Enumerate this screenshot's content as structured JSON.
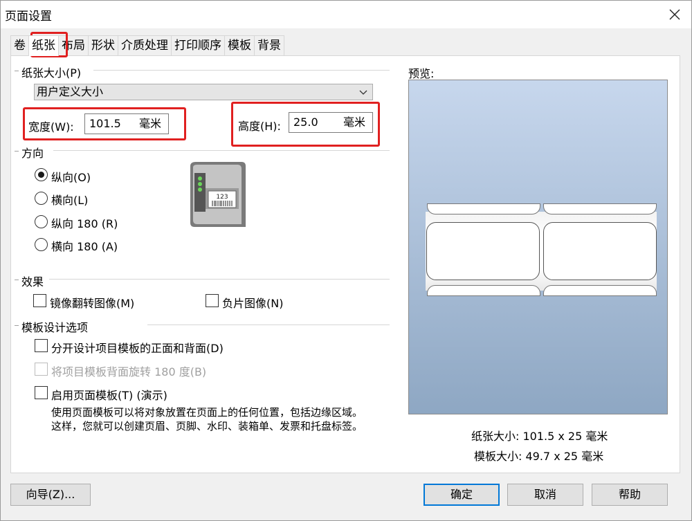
{
  "window": {
    "title": "页面设置"
  },
  "tabs": [
    "卷",
    "纸张",
    "布局",
    "形状",
    "介质处理",
    "打印顺序",
    "模板",
    "背景"
  ],
  "paper_size": {
    "group_label": "纸张大小(P)",
    "selected": "用户定义大小",
    "width_label": "宽度(W):",
    "width_value": "101.5",
    "height_label": "高度(H):",
    "height_value": "25.0",
    "unit": "毫米"
  },
  "orientation": {
    "group_label": "方向",
    "options": [
      "纵向(O)",
      "横向(L)",
      "纵向 180 (R)",
      "横向 180 (A)"
    ],
    "selected_index": 0,
    "printer_text": "123"
  },
  "effects": {
    "group_label": "效果",
    "mirror": "镜像翻转图像(M)",
    "negative": "负片图像(N)"
  },
  "template_options": {
    "group_label": "模板设计选项",
    "separate": "分开设计项目模板的正面和背面(D)",
    "rotate": "将项目模板背面旋转 180 度(B)",
    "enable_page_template": "启用页面模板(T) (演示)",
    "desc_line1": "使用页面模板可以将对象放置在页面上的任何位置，包括边缘区域。",
    "desc_line2": "这样，您就可以创建页眉、页脚、水印、装箱单、发票和托盘标签。"
  },
  "preview": {
    "label": "预览:",
    "paper_size_text": "纸张大小:  101.5 x 25 毫米",
    "template_size_text": "模板大小:  49.7 x 25 毫米"
  },
  "buttons": {
    "wizard": "向导(Z)...",
    "ok": "确定",
    "cancel": "取消",
    "help": "帮助"
  },
  "colors": {
    "highlight": "#e02020",
    "focus": "#0078d7"
  }
}
